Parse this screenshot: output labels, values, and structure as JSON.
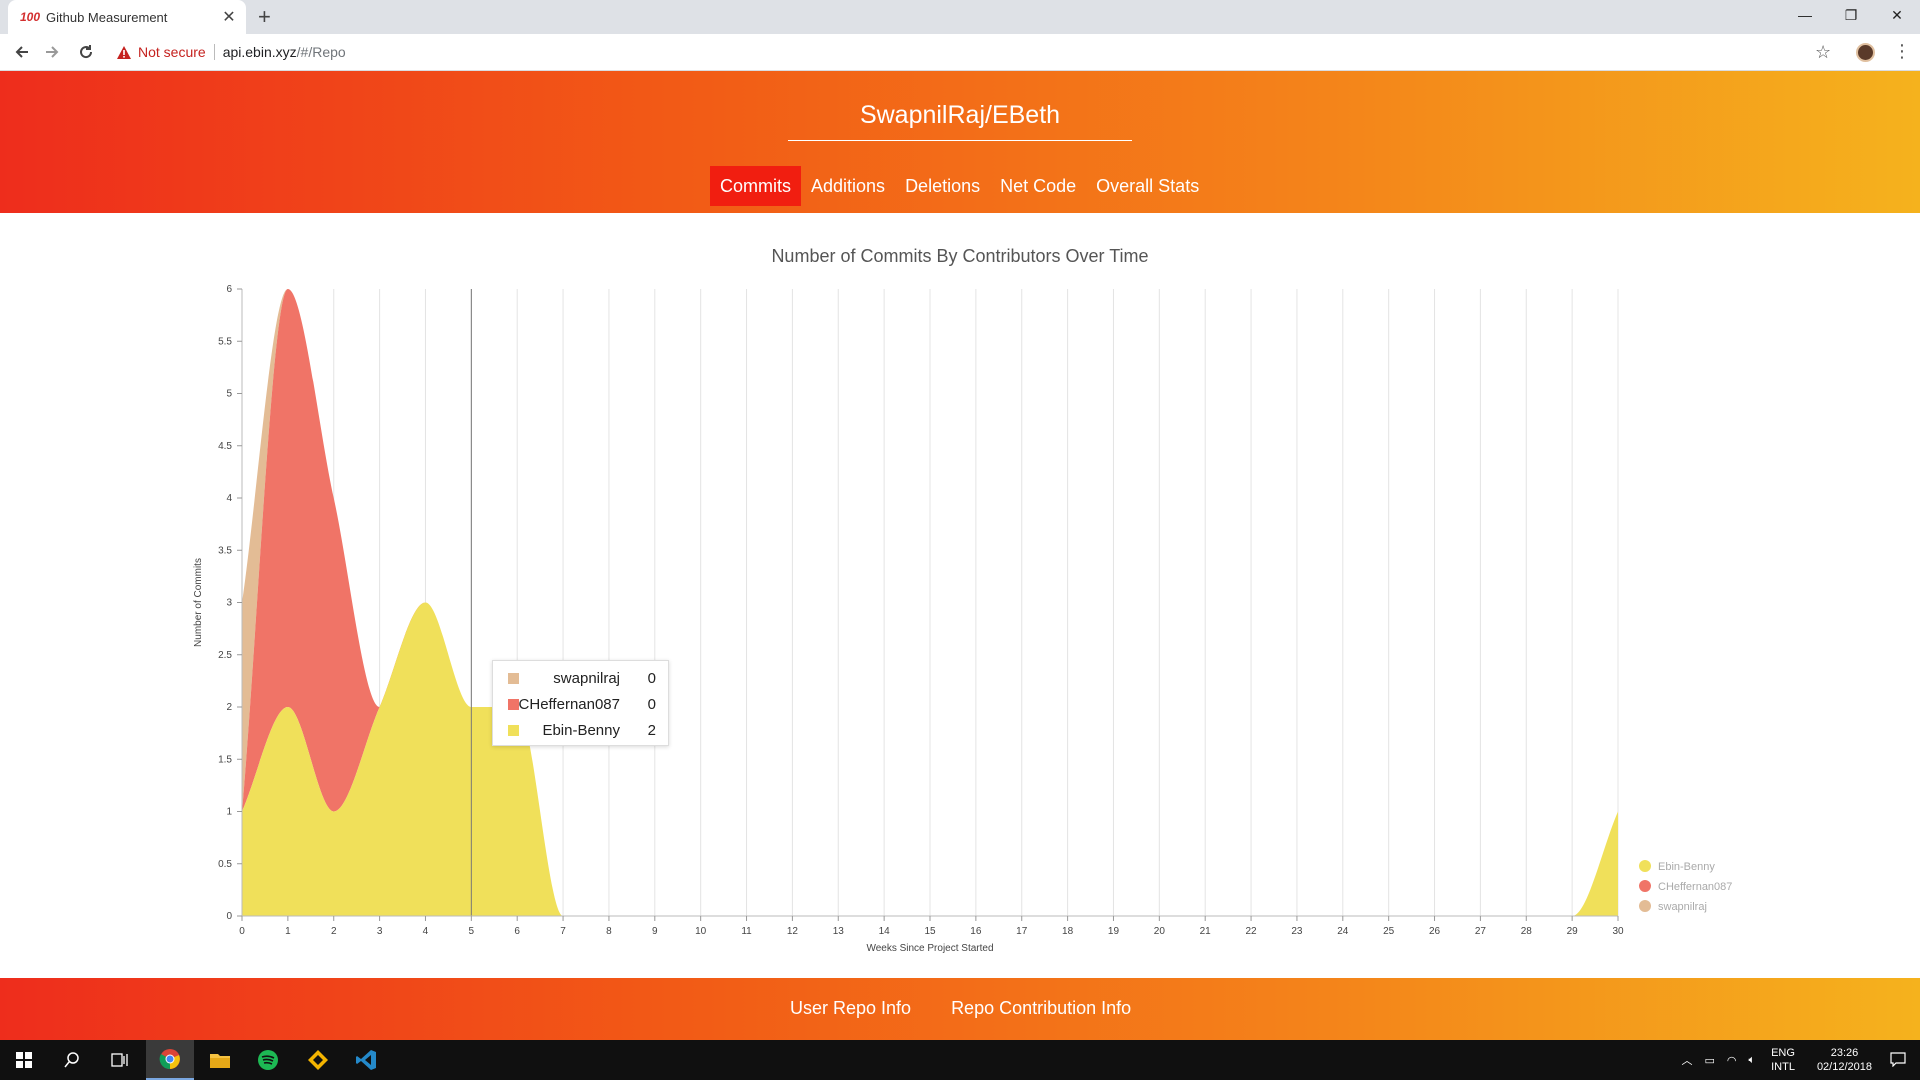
{
  "browser": {
    "tab_title": "Github Measurement",
    "favicon_text": "100",
    "new_tab": "+",
    "security_label": "Not secure",
    "url_host": "api.ebin.xyz",
    "url_path": "/#/Repo"
  },
  "header": {
    "repo_title": "SwapnilRaj/EBeth",
    "tabs": [
      {
        "label": "Commits",
        "active": true
      },
      {
        "label": "Additions",
        "active": false
      },
      {
        "label": "Deletions",
        "active": false
      },
      {
        "label": "Net Code",
        "active": false
      },
      {
        "label": "Overall Stats",
        "active": false
      }
    ]
  },
  "tooltip": {
    "rows": [
      {
        "name": "swapnilraj",
        "value": "0",
        "color": "#e3bc95"
      },
      {
        "name": "CHeffernan087",
        "value": "0",
        "color": "#f07467"
      },
      {
        "name": "Ebin-Benny",
        "value": "2",
        "color": "#f0e05a"
      }
    ]
  },
  "chart_data": {
    "type": "area",
    "stacked": true,
    "title": "Number of Commits By Contributors Over Time",
    "xlabel": "Weeks Since Project Started",
    "ylabel": "Number of Commits",
    "xlim": [
      0,
      30
    ],
    "ylim": [
      0,
      6
    ],
    "yticks": [
      "0",
      "0.5",
      "1",
      "1.5",
      "2",
      "2.5",
      "3",
      "3.5",
      "4",
      "4.5",
      "5",
      "5.5",
      "6"
    ],
    "x": [
      0,
      1,
      2,
      3,
      4,
      5,
      6,
      7,
      8,
      9,
      10,
      11,
      12,
      13,
      14,
      15,
      16,
      17,
      18,
      19,
      20,
      21,
      22,
      23,
      24,
      25,
      26,
      27,
      28,
      29,
      30
    ],
    "grid": "vertical",
    "legend_position": "bottom-right",
    "hover_week": 5,
    "series": [
      {
        "name": "Ebin-Benny",
        "color": "#f0e05a",
        "values": [
          1,
          2,
          1,
          2,
          3,
          2,
          2,
          0,
          0,
          0,
          0,
          0,
          0,
          0,
          0,
          0,
          0,
          0,
          0,
          0,
          0,
          0,
          0,
          0,
          0,
          0,
          0,
          0,
          0,
          0,
          1
        ]
      },
      {
        "name": "CHeffernan087",
        "color": "#f07467",
        "values": [
          0,
          4,
          3,
          0,
          0,
          0,
          0,
          0,
          0,
          0,
          0,
          0,
          0,
          0,
          0,
          0,
          0,
          0,
          0,
          0,
          0,
          0,
          0,
          0,
          0,
          0,
          0,
          0,
          0,
          0,
          0
        ]
      },
      {
        "name": "swapnilraj",
        "color": "#e3bc95",
        "values": [
          2,
          0,
          0,
          0,
          0,
          0,
          0,
          0,
          0,
          0,
          0,
          0,
          0,
          0,
          0,
          0,
          0,
          0,
          0,
          0,
          0,
          0,
          0,
          0,
          0,
          0,
          0,
          0,
          0,
          0,
          0
        ]
      }
    ]
  },
  "footer": {
    "links": [
      "User Repo Info",
      "Repo Contribution Info"
    ]
  },
  "taskbar": {
    "lang_top": "ENG",
    "lang_bottom": "INTL",
    "time": "23:26",
    "date": "02/12/2018"
  }
}
